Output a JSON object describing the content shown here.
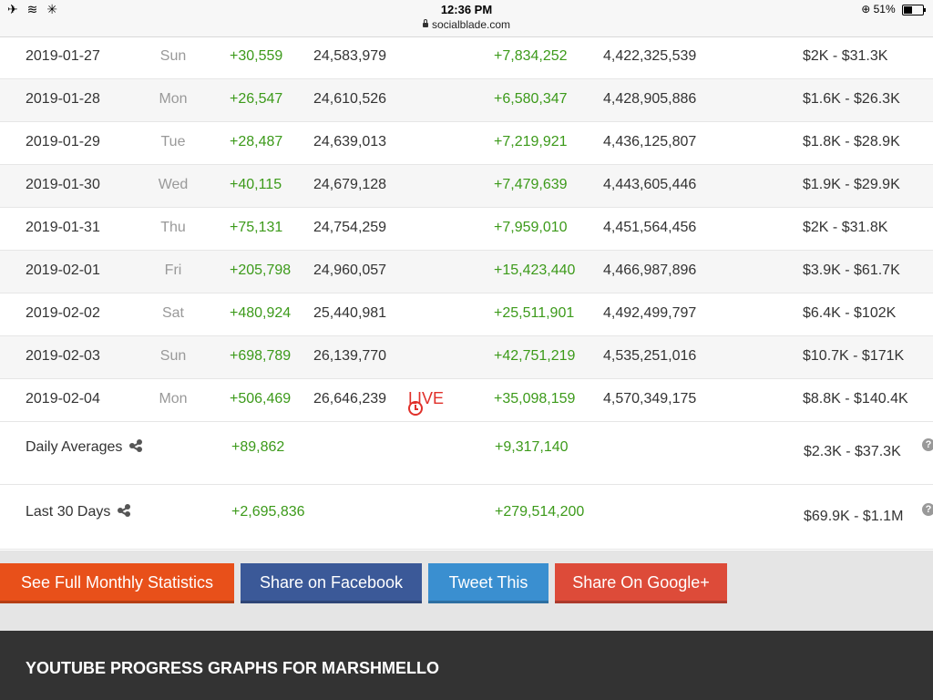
{
  "status_bar": {
    "time": "12:36 PM",
    "url": "socialblade.com",
    "battery": "51%",
    "battery_level": 0.51,
    "icons": [
      "airplane-icon",
      "wifi-icon",
      "loading-icon",
      "lock-icon",
      "orientation-lock-icon",
      "battery-icon"
    ]
  },
  "rows": [
    {
      "date": "2019-01-27",
      "day": "Sun",
      "sub_delta": "+30,559",
      "subs": "24,583,979",
      "live": "",
      "view_delta": "+7,834,252",
      "views": "4,422,325,539",
      "earnings": "$2K  -  $31.3K"
    },
    {
      "date": "2019-01-28",
      "day": "Mon",
      "sub_delta": "+26,547",
      "subs": "24,610,526",
      "live": "",
      "view_delta": "+6,580,347",
      "views": "4,428,905,886",
      "earnings": "$1.6K  -  $26.3K"
    },
    {
      "date": "2019-01-29",
      "day": "Tue",
      "sub_delta": "+28,487",
      "subs": "24,639,013",
      "live": "",
      "view_delta": "+7,219,921",
      "views": "4,436,125,807",
      "earnings": "$1.8K  -  $28.9K"
    },
    {
      "date": "2019-01-30",
      "day": "Wed",
      "sub_delta": "+40,115",
      "subs": "24,679,128",
      "live": "",
      "view_delta": "+7,479,639",
      "views": "4,443,605,446",
      "earnings": "$1.9K  -  $29.9K"
    },
    {
      "date": "2019-01-31",
      "day": "Thu",
      "sub_delta": "+75,131",
      "subs": "24,754,259",
      "live": "",
      "view_delta": "+7,959,010",
      "views": "4,451,564,456",
      "earnings": "$2K  -  $31.8K"
    },
    {
      "date": "2019-02-01",
      "day": "Fri",
      "sub_delta": "+205,798",
      "subs": "24,960,057",
      "live": "",
      "view_delta": "+15,423,440",
      "views": "4,466,987,896",
      "earnings": "$3.9K  -  $61.7K"
    },
    {
      "date": "2019-02-02",
      "day": "Sat",
      "sub_delta": "+480,924",
      "subs": "25,440,981",
      "live": "",
      "view_delta": "+25,511,901",
      "views": "4,492,499,797",
      "earnings": "$6.4K  -  $102K"
    },
    {
      "date": "2019-02-03",
      "day": "Sun",
      "sub_delta": "+698,789",
      "subs": "26,139,770",
      "live": "",
      "view_delta": "+42,751,219",
      "views": "4,535,251,016",
      "earnings": "$10.7K  -  $171K"
    },
    {
      "date": "2019-02-04",
      "day": "Mon",
      "sub_delta": "+506,469",
      "subs": "26,646,239",
      "live": "LIVE",
      "view_delta": "+35,098,159",
      "views": "4,570,349,175",
      "earnings": "$8.8K  -  $140.4K"
    }
  ],
  "summary": [
    {
      "label": "Daily Averages",
      "sub_delta": "+89,862",
      "view_delta": "+9,317,140",
      "earnings": "$2.3K  -  $37.3K"
    },
    {
      "label": "Last 30 Days",
      "sub_delta": "+2,695,836",
      "view_delta": "+279,514,200",
      "earnings": "$69.9K  -  $1.1M"
    }
  ],
  "buttons": [
    {
      "label": "See Full Monthly Statistics",
      "color": "#e8501a"
    },
    {
      "label": "Share on Facebook",
      "color": "#3b5998"
    },
    {
      "label": "Tweet This",
      "color": "#3a8fd0"
    },
    {
      "label": "Share On Google+",
      "color": "#dd4b39"
    }
  ],
  "footer": {
    "title": "YOUTUBE PROGRESS GRAPHS FOR MARSHMELLO"
  },
  "colors": {
    "positive": "#3c9a1a",
    "live": "#e0302a",
    "footer_bg": "#333333"
  }
}
